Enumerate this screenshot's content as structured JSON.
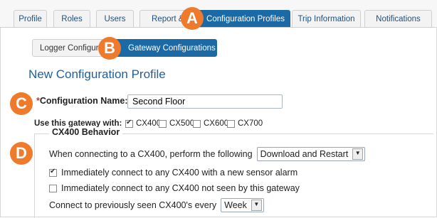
{
  "tabs": [
    {
      "label": "Profile"
    },
    {
      "label": "Roles"
    },
    {
      "label": "Users"
    },
    {
      "label": "Report & Ex"
    },
    {
      "label": "Configuration Profiles"
    },
    {
      "label": "Trip Information"
    },
    {
      "label": "Notifications"
    }
  ],
  "subtabs": [
    {
      "label": "Logger Configura"
    },
    {
      "label": "Gateway Configurations"
    }
  ],
  "page_title": "New Configuration Profile",
  "config_name": {
    "label": "Configuration Name:",
    "required_mark": "*",
    "value": "Second Floor"
  },
  "gateway": {
    "label": "Use this gateway with:",
    "options": [
      {
        "label": "CX400",
        "checked": true
      },
      {
        "label": "CX500",
        "checked": false
      },
      {
        "label": "CX600",
        "checked": false
      },
      {
        "label": "CX700",
        "checked": false
      }
    ]
  },
  "behavior": {
    "legend": "CX400 Behavior",
    "connect_label": "When connecting to a CX400, perform the following",
    "connect_action": "Download and Restart",
    "options": [
      {
        "label": "Immediately connect to any CX400 with a new sensor alarm",
        "checked": true
      },
      {
        "label": "Immediately connect to any CX400 not seen by this gateway",
        "checked": false
      }
    ],
    "frequency_label": "Connect to previously seen CX400's every",
    "frequency_value": "Week"
  },
  "callouts": [
    "A",
    "B",
    "C",
    "D"
  ],
  "colors": {
    "accent": "#1b6aa6",
    "callout": "#ef7a2b",
    "title": "#1f5f9a"
  }
}
